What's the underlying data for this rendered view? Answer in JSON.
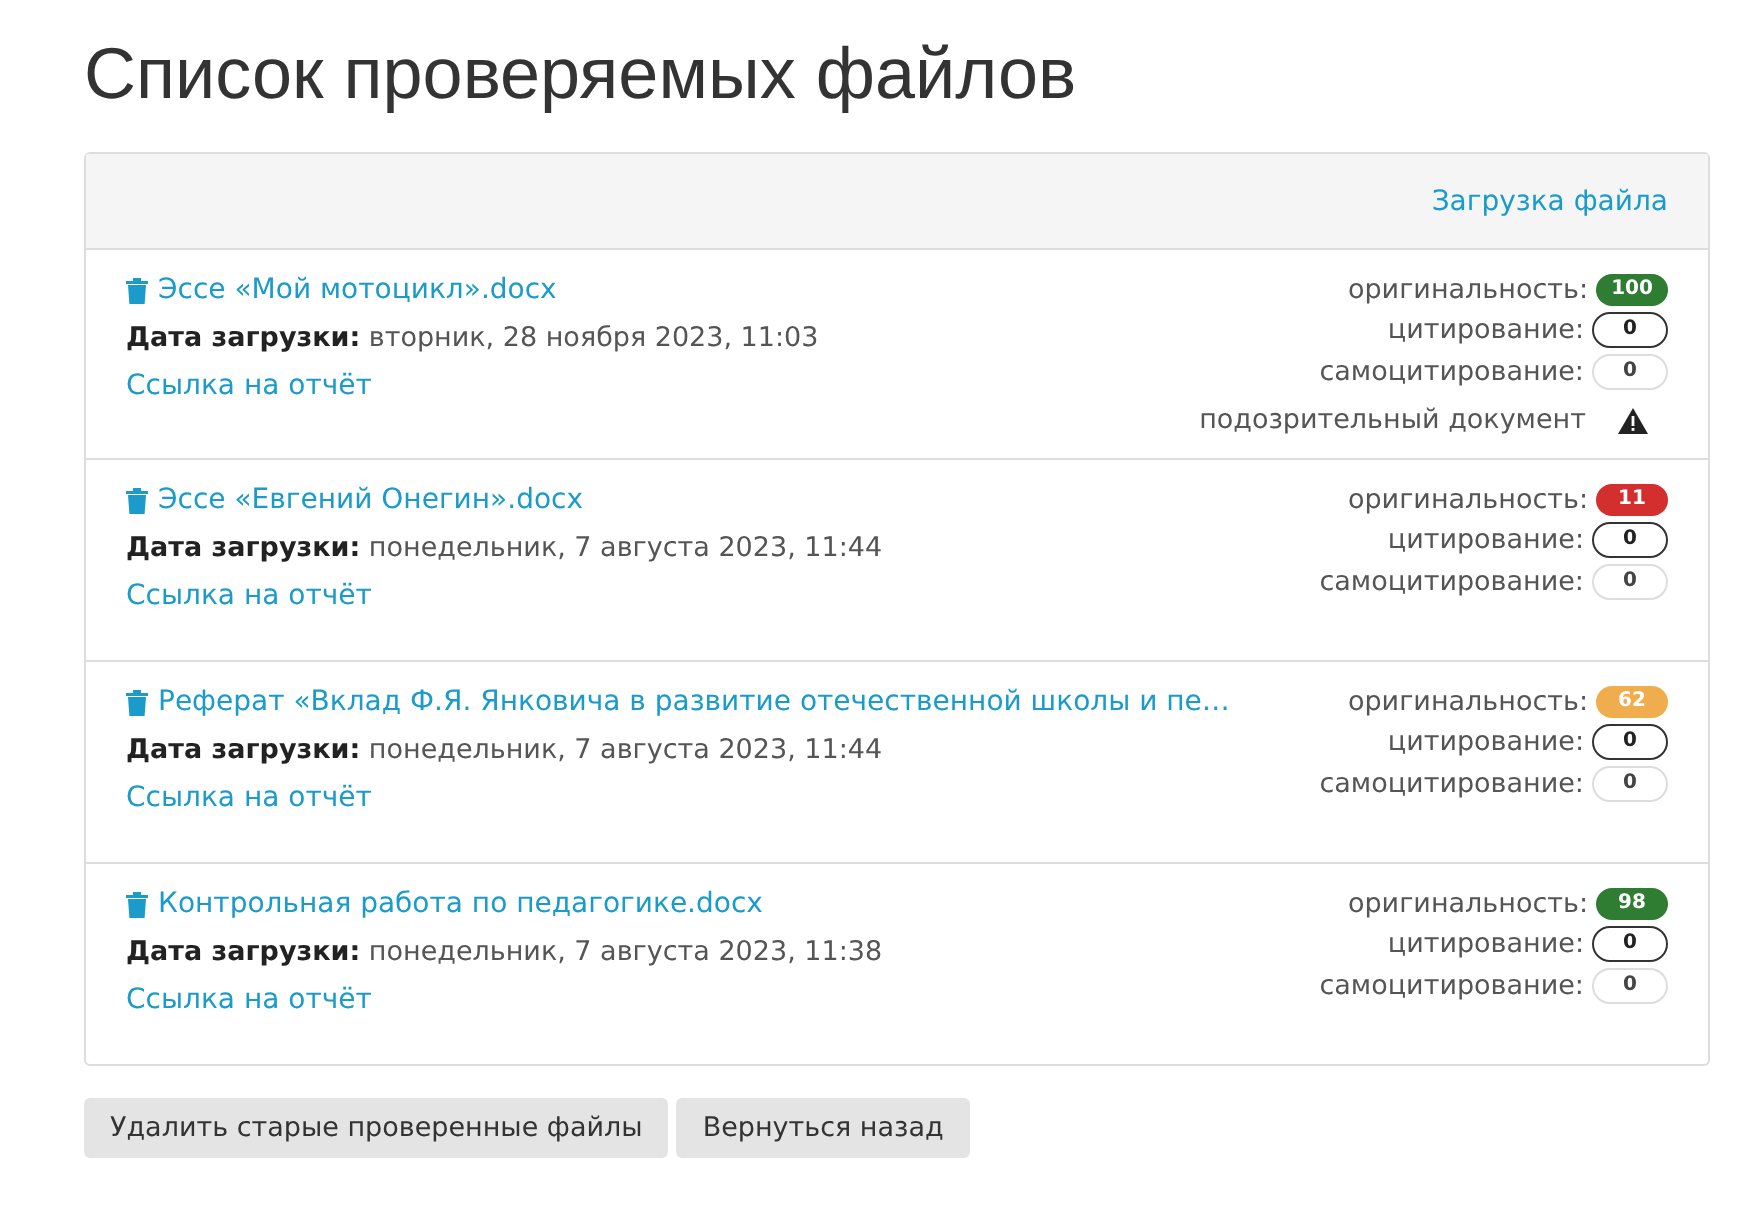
{
  "title": "Список проверяемых файлов",
  "panel": {
    "upload_link": "Загрузка файла"
  },
  "files": [
    {
      "name": "Эссе «Мой мотоцикл».docx",
      "date_label": "Дата загрузки:",
      "date": "вторник, 28 ноября 2023, 11:03",
      "report_link": "Ссылка на отчёт",
      "suspicious": true,
      "suspicious_label": "подозрительный документ",
      "metrics": [
        {
          "kind": "filled",
          "label": "оригинальность:",
          "value": "100",
          "color": "#2e7d32"
        },
        {
          "kind": "outlined",
          "label": "цитирование:",
          "value": "0"
        },
        {
          "kind": "faint",
          "label": "самоцитирование:",
          "value": "0"
        }
      ]
    },
    {
      "name": "Эссе «Евгений Онегин».docx",
      "date_label": "Дата загрузки:",
      "date": "понедельник, 7 августа 2023, 11:44",
      "report_link": "Ссылка на отчёт",
      "suspicious": false,
      "metrics": [
        {
          "kind": "filled",
          "label": "оригинальность:",
          "value": "11",
          "color": "#d32f2f"
        },
        {
          "kind": "outlined",
          "label": "цитирование:",
          "value": "0"
        },
        {
          "kind": "faint",
          "label": "самоцитирование:",
          "value": "0"
        }
      ]
    },
    {
      "name": "Реферат «Вклад Ф.Я. Янковича в развитие отечественной школы и пе…",
      "date_label": "Дата загрузки:",
      "date": "понедельник, 7 августа 2023, 11:44",
      "report_link": "Ссылка на отчёт",
      "suspicious": false,
      "metrics": [
        {
          "kind": "filled",
          "label": "оригинальность:",
          "value": "62",
          "color": "#f0ad4e"
        },
        {
          "kind": "outlined",
          "label": "цитирование:",
          "value": "0"
        },
        {
          "kind": "faint",
          "label": "самоцитирование:",
          "value": "0"
        }
      ]
    },
    {
      "name": "Контрольная работа по педагогике.docx",
      "date_label": "Дата загрузки:",
      "date": "понедельник, 7 августа 2023, 11:38",
      "report_link": "Ссылка на отчёт",
      "suspicious": false,
      "metrics": [
        {
          "kind": "filled",
          "label": "оригинальность:",
          "value": "98",
          "color": "#2e7d32"
        },
        {
          "kind": "outlined",
          "label": "цитирование:",
          "value": "0"
        },
        {
          "kind": "faint",
          "label": "самоцитирование:",
          "value": "0"
        }
      ]
    }
  ],
  "buttons": [
    "Удалить старые проверенные файлы",
    "Вернуться назад"
  ]
}
